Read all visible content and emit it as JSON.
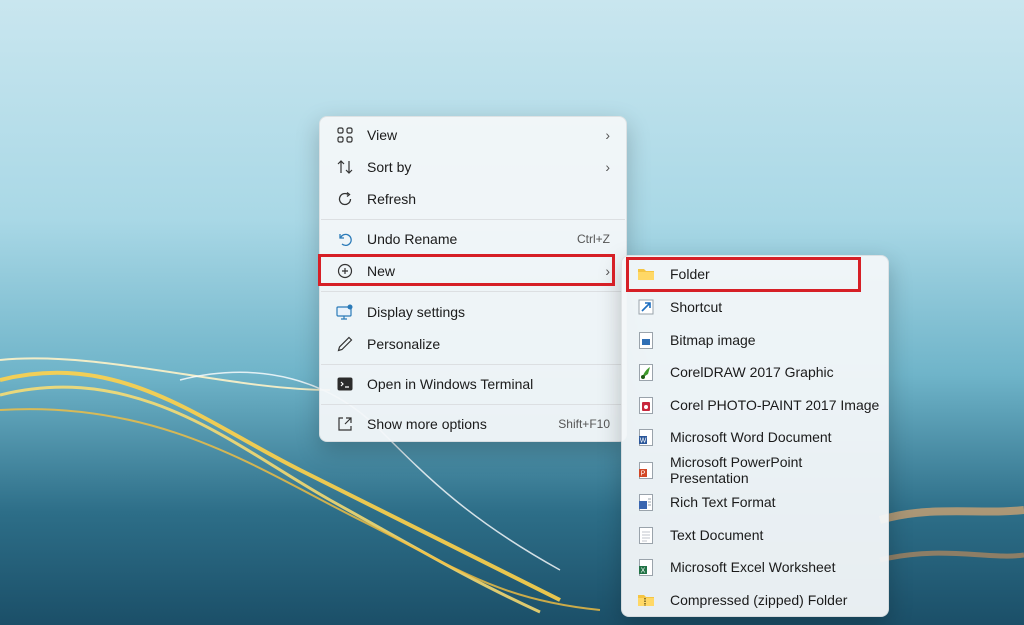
{
  "desktop": {
    "context_menu": {
      "items": [
        {
          "label": "View",
          "icon": "grid-icon",
          "chevron": "›"
        },
        {
          "label": "Sort by",
          "icon": "sort-icon",
          "chevron": "›"
        },
        {
          "label": "Refresh",
          "icon": "refresh-icon"
        },
        {
          "label": "Undo Rename",
          "icon": "undo-icon",
          "shortcut": "Ctrl+Z"
        },
        {
          "label": "New",
          "icon": "plus-circle-icon",
          "chevron": "›"
        },
        {
          "label": "Display settings",
          "icon": "display-icon"
        },
        {
          "label": "Personalize",
          "icon": "pen-icon"
        },
        {
          "label": "Open in Windows Terminal",
          "icon": "terminal-icon"
        },
        {
          "label": "Show more options",
          "icon": "more-options-icon",
          "shortcut": "Shift+F10"
        }
      ]
    },
    "new_submenu": {
      "items": [
        {
          "label": "Folder",
          "icon": "folder-icon"
        },
        {
          "label": "Shortcut",
          "icon": "shortcut-icon"
        },
        {
          "label": "Bitmap image",
          "icon": "bitmap-icon"
        },
        {
          "label": "CorelDRAW 2017 Graphic",
          "icon": "coreldraw-icon"
        },
        {
          "label": "Corel PHOTO-PAINT 2017 Image",
          "icon": "photopaint-icon"
        },
        {
          "label": "Microsoft Word Document",
          "icon": "word-icon"
        },
        {
          "label": "Microsoft PowerPoint Presentation",
          "icon": "powerpoint-icon"
        },
        {
          "label": "Rich Text Format",
          "icon": "rtf-icon"
        },
        {
          "label": "Text Document",
          "icon": "text-document-icon"
        },
        {
          "label": "Microsoft Excel Worksheet",
          "icon": "excel-icon"
        },
        {
          "label": "Compressed (zipped) Folder",
          "icon": "zip-folder-icon"
        }
      ]
    },
    "highlight_color": "#d61f26"
  }
}
